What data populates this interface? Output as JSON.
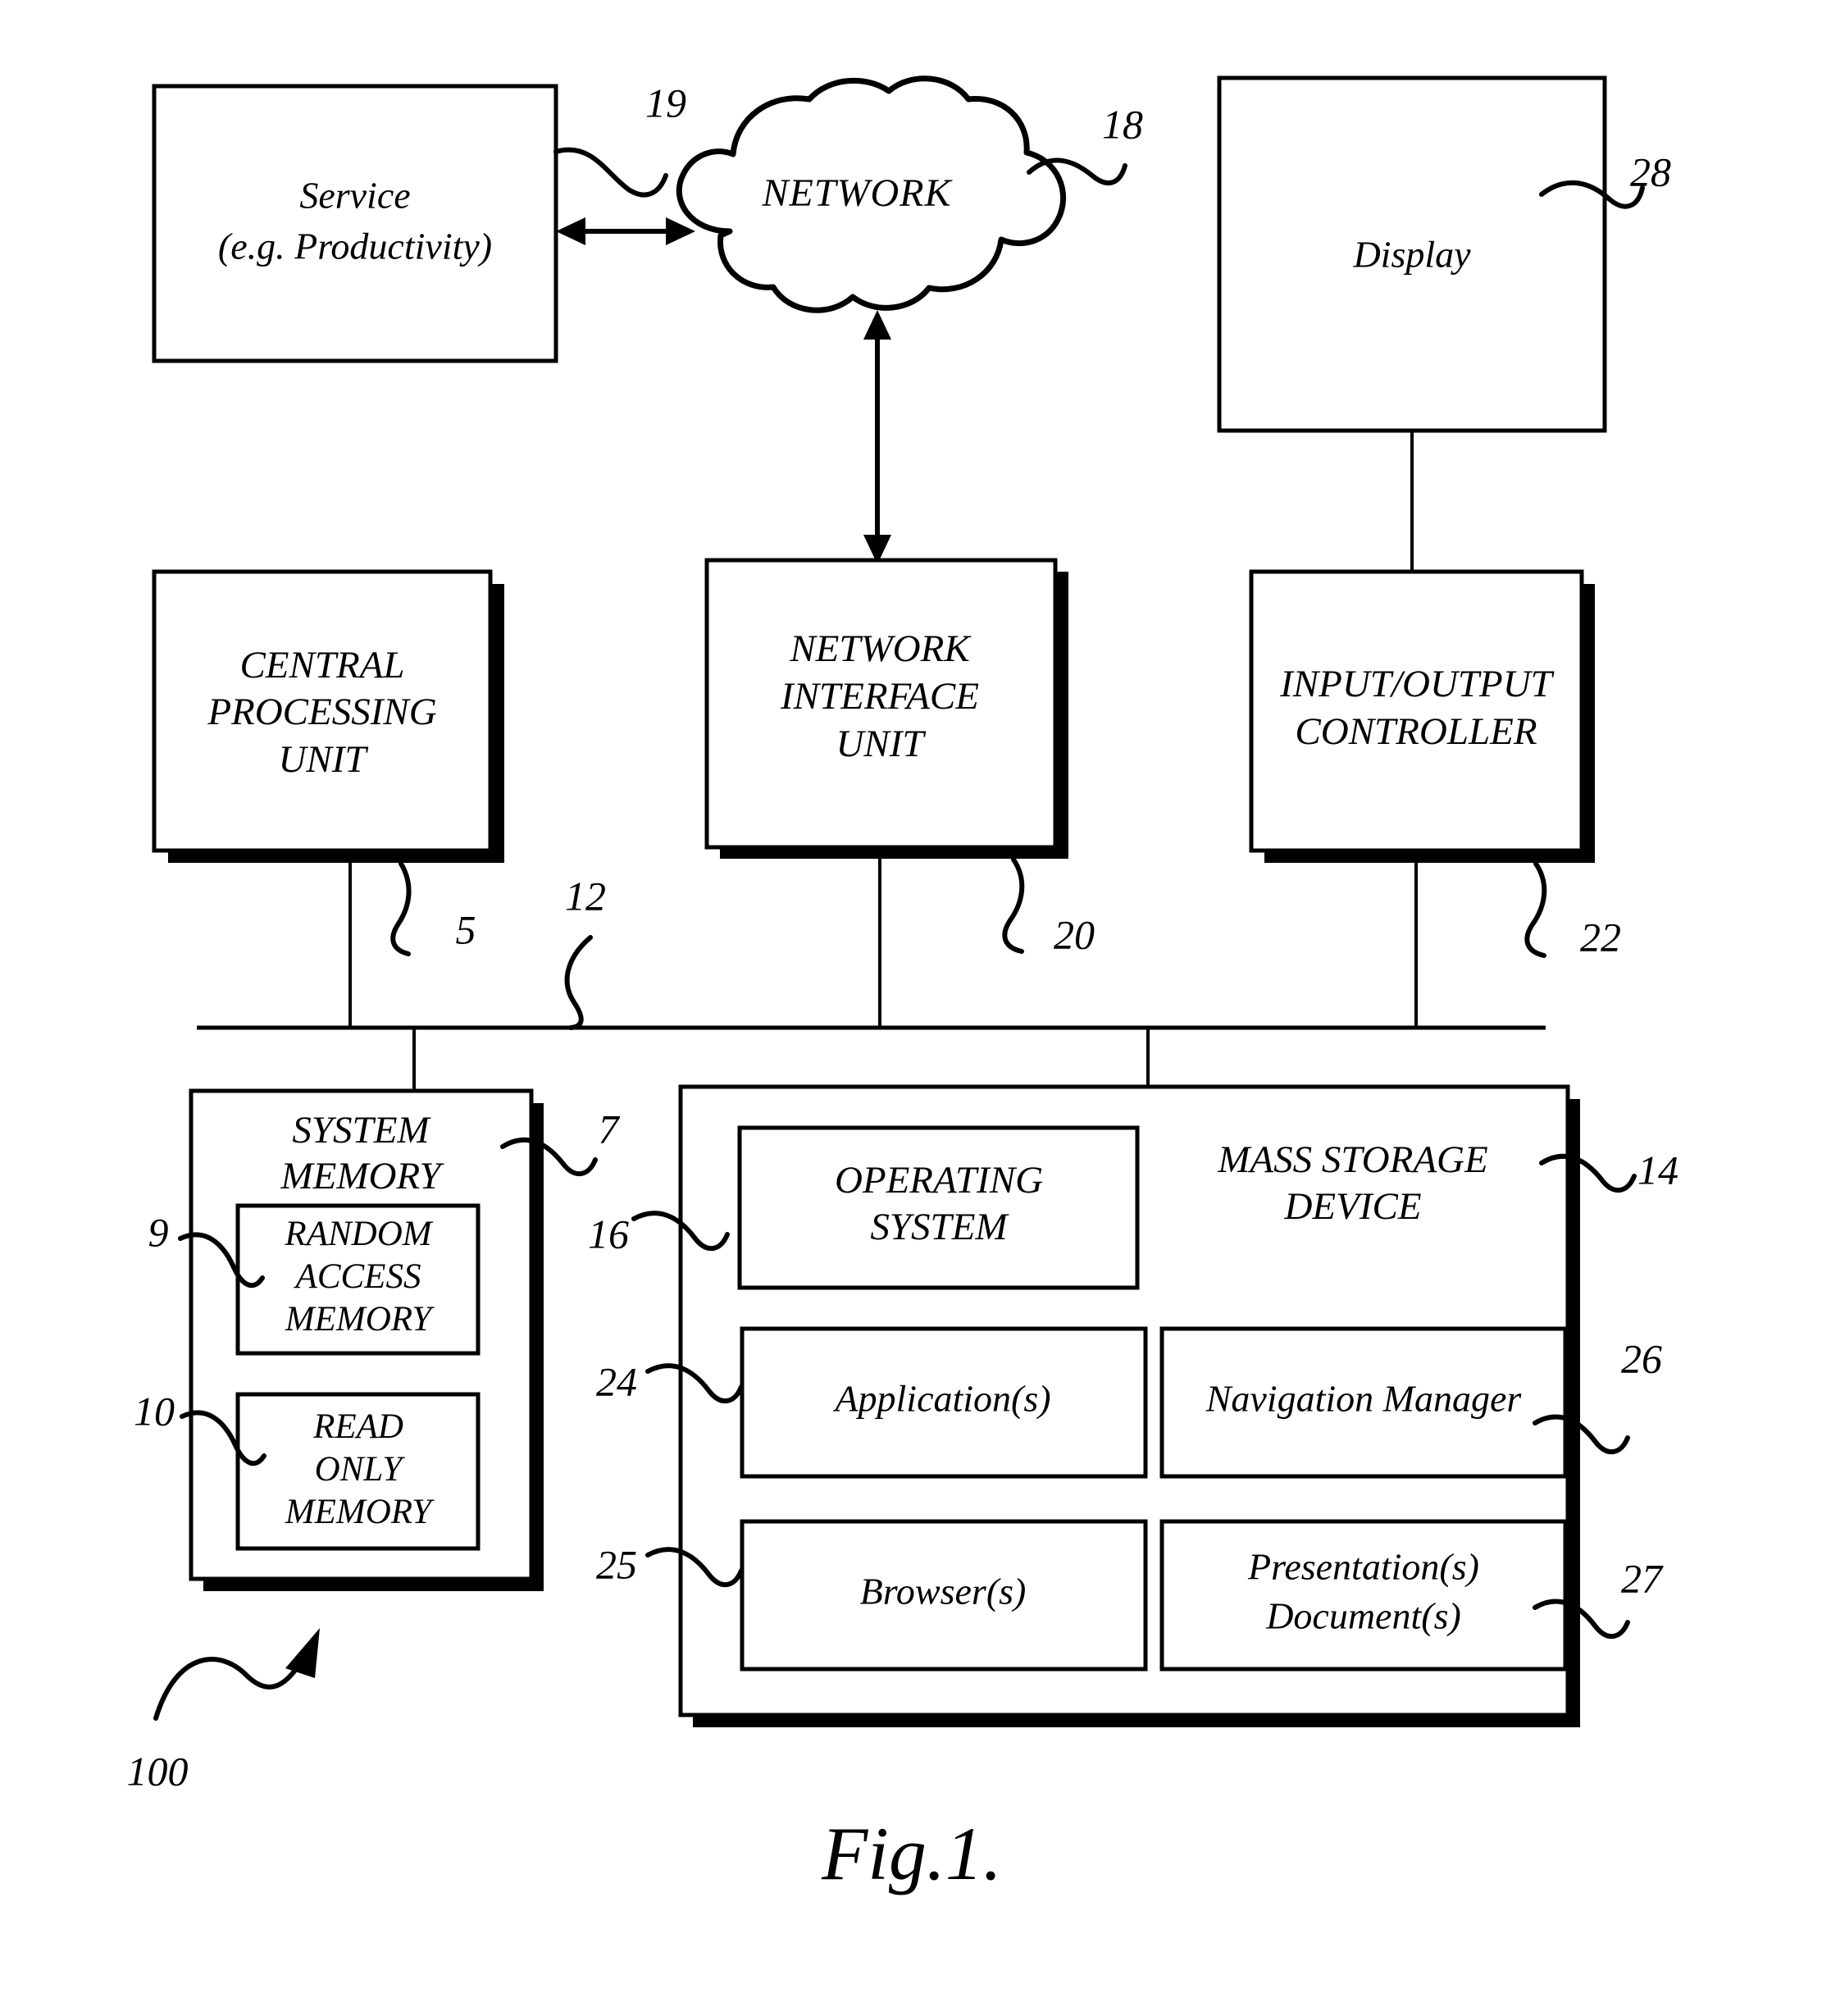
{
  "figure": {
    "caption": "Fig.1.",
    "system_ref": "100"
  },
  "nodes": {
    "service": {
      "line1": "Service",
      "line2": "(e.g. Productivity)",
      "ref": "19"
    },
    "network_cloud": {
      "label": "NETWORK",
      "ref": "18"
    },
    "display": {
      "label": "Display",
      "ref": "28"
    },
    "cpu": {
      "line1": "CENTRAL",
      "line2": "PROCESSING",
      "line3": "UNIT",
      "ref": "5"
    },
    "network_interface_unit": {
      "line1": "NETWORK",
      "line2": "INTERFACE",
      "line3": "UNIT",
      "ref": "20"
    },
    "io_controller": {
      "line1": "INPUT/OUTPUT",
      "line2": "CONTROLLER",
      "ref": "22"
    },
    "bus": {
      "ref": "12"
    },
    "system_memory": {
      "line1": "SYSTEM",
      "line2": "MEMORY",
      "ref": "7"
    },
    "random_access_memory": {
      "line1": "RANDOM",
      "line2": "ACCESS",
      "line3": "MEMORY",
      "ref": "9"
    },
    "read_only_memory": {
      "line1": "READ",
      "line2": "ONLY",
      "line3": "MEMORY",
      "ref": "10"
    },
    "mass_storage_device": {
      "line1": "MASS STORAGE",
      "line2": "DEVICE",
      "ref": "14"
    },
    "operating_system": {
      "line1": "OPERATING",
      "line2": "SYSTEM",
      "ref": "16"
    },
    "applications": {
      "label": "Application(s)",
      "ref": "24"
    },
    "navigation_manager": {
      "label": "Navigation Manager",
      "ref": "26"
    },
    "browsers": {
      "label": "Browser(s)",
      "ref": "25"
    },
    "presentation_documents": {
      "line1": "Presentation(s)",
      "line2": "Document(s)",
      "ref": "27"
    }
  }
}
